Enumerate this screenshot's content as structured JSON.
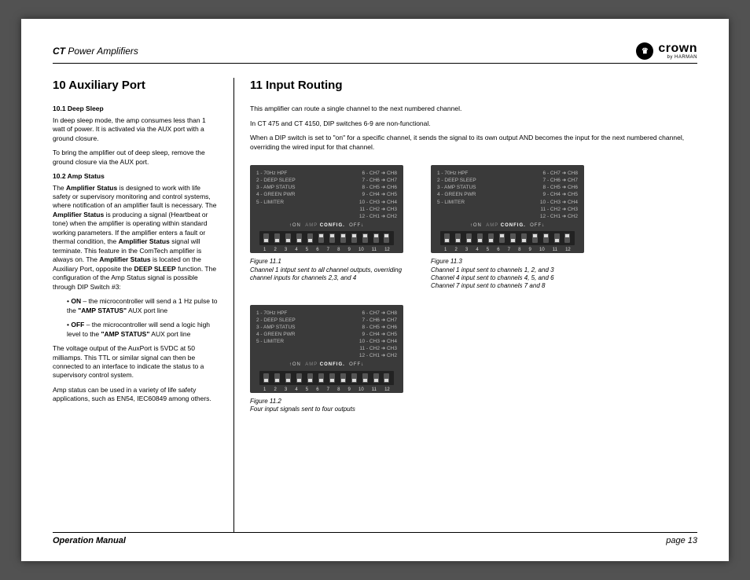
{
  "header": {
    "product_prefix": "CT",
    "product_rest": " Power Amplifiers",
    "brand": "crown",
    "brand_sub": "by HARMAN",
    "brand_symbol": "♛"
  },
  "col_left": {
    "title": "10 Auxiliary Port",
    "s1_title": "10.1 Deep Sleep",
    "s1_p1": "In deep sleep mode, the amp consumes less than 1 watt of power. It is activated via the AUX port with a ground closure.",
    "s1_p2": "To bring the amplifier out of deep sleep, remove the ground closure via the AUX port.",
    "s2_title": "10.2 Amp Status",
    "s2_p1a": "The ",
    "s2_p1b": "Amplifier Status",
    "s2_p1c": " is designed to work with life safety or supervisory monitoring and control systems, where notification of an amplifier fault is necessary. The ",
    "s2_p1d": "Amplifier Status",
    "s2_p1e": " is producing a signal (Heartbeat or tone) when the amplifier is operating within standard working parameters. If the amplifier enters a fault or thermal condition, the ",
    "s2_p1f": "Amplifier Status",
    "s2_p1g": " signal will terminate. This feature in the ComTech amplifier is always on. The ",
    "s2_p1h": "Amplifier Status",
    "s2_p1i": " is located on the Auxiliary Port, opposite the ",
    "s2_p1j": "DEEP SLEEP",
    "s2_p1k": " function. The configuration of the Amp Status signal is possible through DIP Switch #3:",
    "bullet_on_a": "ON",
    "bullet_on_b": " – the microcontroller will send a 1 Hz pulse to the ",
    "bullet_on_c": "\"AMP STATUS\"",
    "bullet_on_d": " AUX port line",
    "bullet_off_a": "OFF",
    "bullet_off_b": " – the microcontroller will send a logic high level to the ",
    "bullet_off_c": "\"AMP STATUS\"",
    "bullet_off_d": " AUX port line",
    "s2_p2": "The voltage output of the AuxPort is 5VDC at 50 milliamps. This TTL or similar signal can then be connected to an interface to indicate the status to a supervisory control system.",
    "s2_p3": "Amp status can be used in a variety of life safety applications, such as EN54, IEC60849 among others."
  },
  "col_right": {
    "title": "11 Input Routing",
    "p1": "This amplifier can route a single channel to the next numbered channel.",
    "p2": "In CT 475 and CT 4150, DIP switches 6-9 are non-functional.",
    "p3": "When a DIP switch is set to \"on\" for a specific channel, it sends the signal to its own output AND becomes the input for the next numbered channel, overriding the wired input for that channel."
  },
  "dip_labels": {
    "left": [
      "1 - 70Hz HPF",
      "2 - DEEP SLEEP",
      "3 - AMP STATUS",
      "4 - GREEN PWR",
      "5 - LIMITER"
    ],
    "right": [
      "6 - CH7 ➜ CH8",
      "7 - CH6 ➜ CH7",
      "8 - CH5 ➜ CH6",
      "9 - CH4 ➜ CH5",
      "10 - CH3 ➜ CH4",
      "11 - CH2 ➜ CH3",
      "12 - CH1 ➜ CH2"
    ],
    "mid_on": "↑ON",
    "mid_amp": "AMP",
    "mid_config": "CONFIG.",
    "mid_off": "OFF↓",
    "nums": [
      "1",
      "2",
      "3",
      "4",
      "5",
      "6",
      "7",
      "8",
      "9",
      "10",
      "11",
      "12"
    ]
  },
  "captions": {
    "f11_1_t": "Figure 11.1",
    "f11_1_d": "Channel 1 intput sent to all channel outputs, overriding channel inputs for channels 2,3, and 4",
    "f11_2_t": "Figure 11.2",
    "f11_2_d": "Four input signals sent to four outputs",
    "f11_3_t": "Figure 11.3",
    "f11_3_d": "Channel 1 input sent to channels 1, 2, and 3\nChannel 4 input sent to channels 4, 5, and 6\nChannel 7 input sent to channels 7 and 8"
  },
  "footer": {
    "left": "Operation Manual",
    "right": "page 13"
  }
}
